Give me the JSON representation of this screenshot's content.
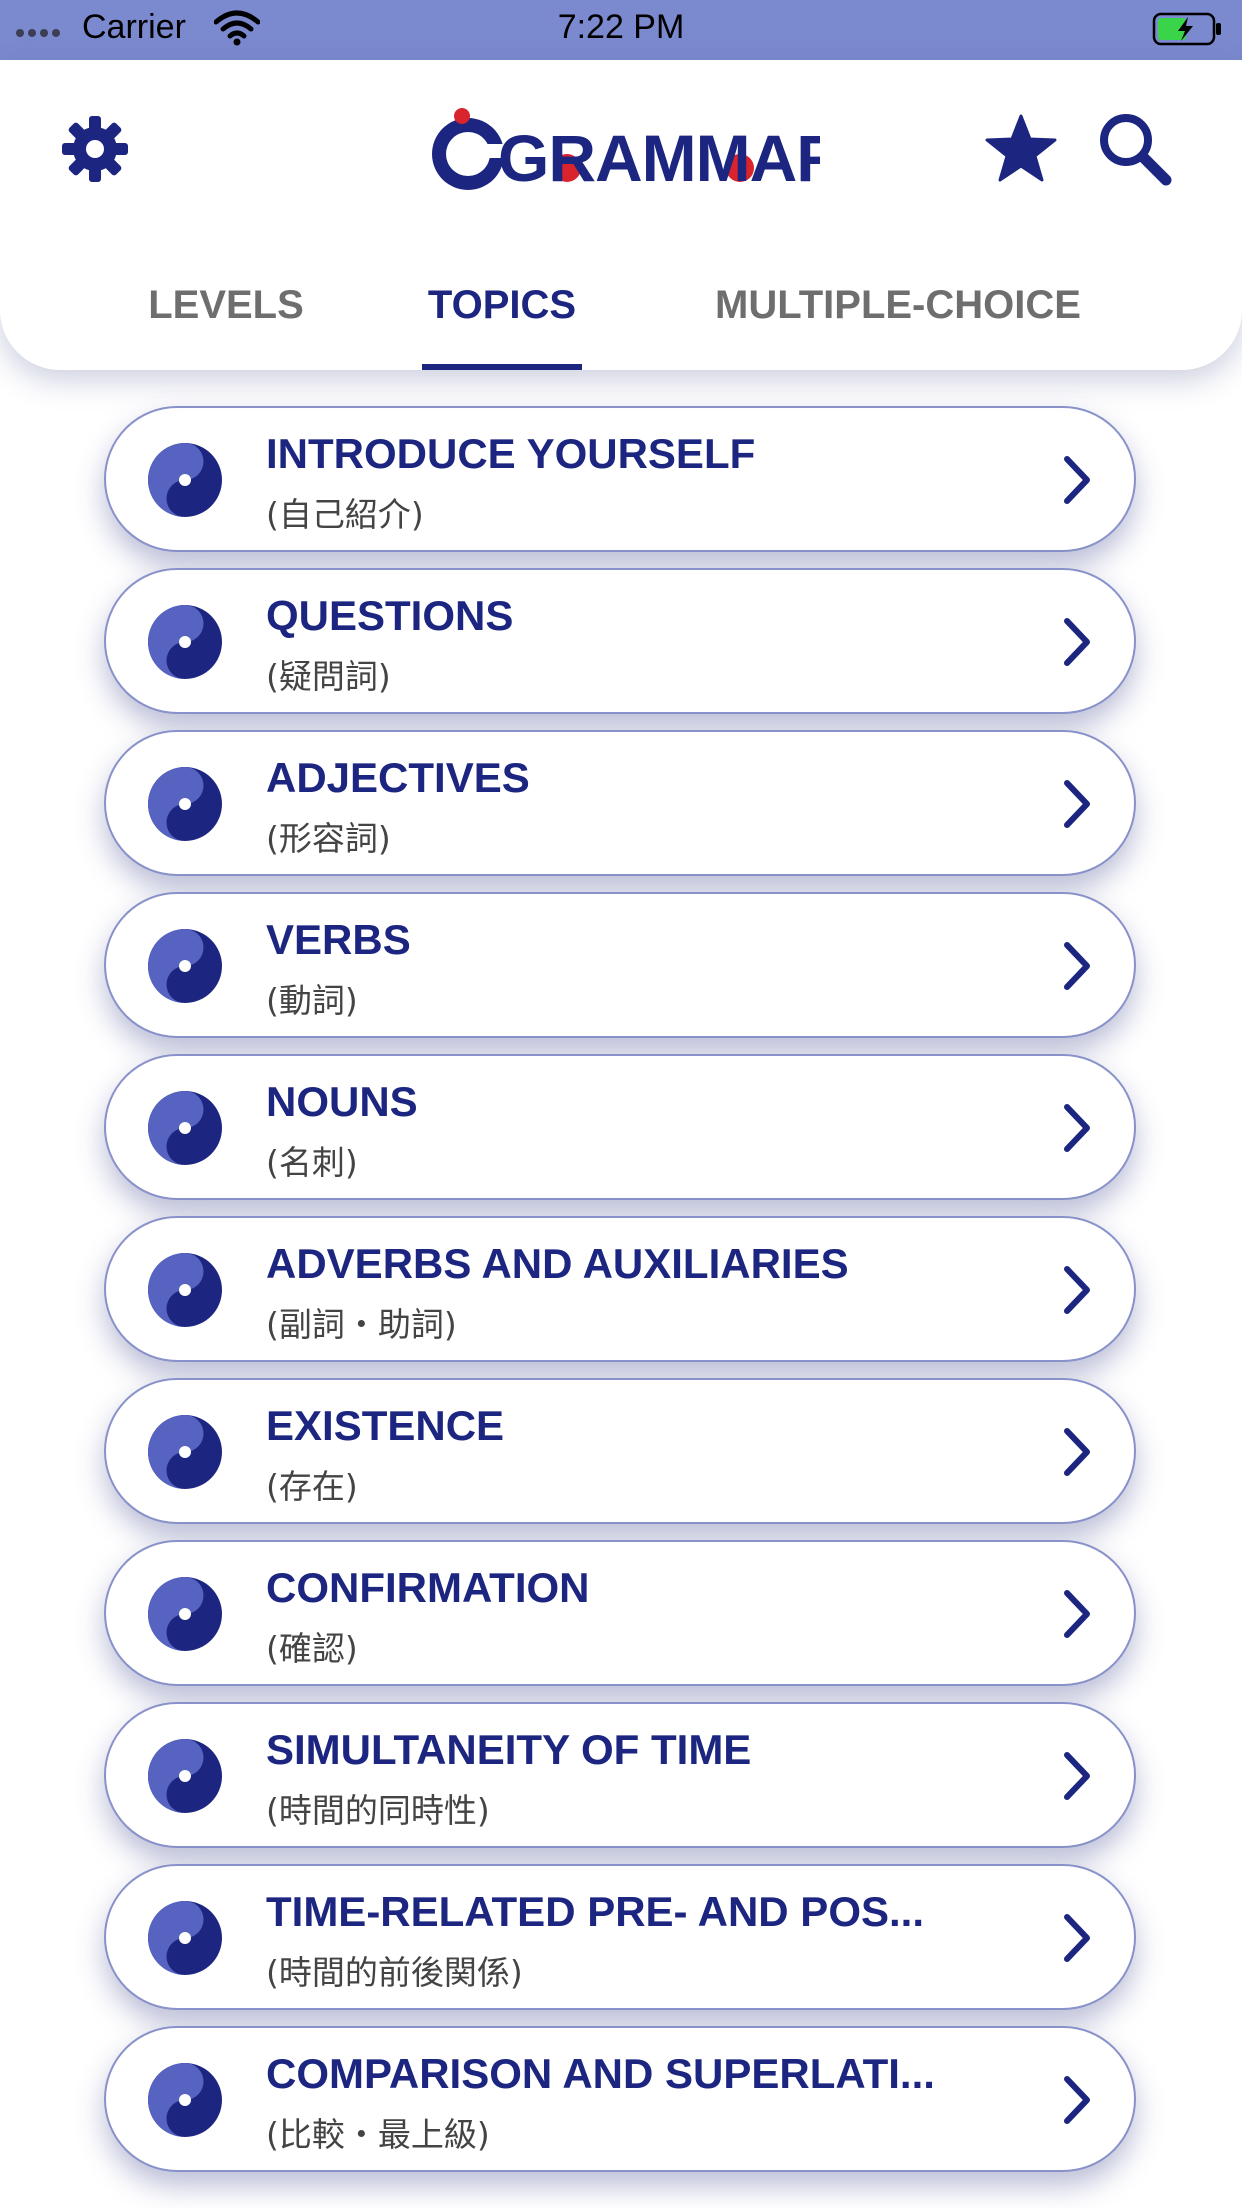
{
  "status_bar": {
    "carrier": "Carrier",
    "time": "7:22 PM"
  },
  "header": {
    "logo_text": "GRAMMAR",
    "icons": {
      "settings": "gear-icon",
      "favorites": "star-icon",
      "search": "search-icon"
    }
  },
  "tabs": [
    {
      "label": "LEVELS",
      "active": false
    },
    {
      "label": "TOPICS",
      "active": true
    },
    {
      "label": "MULTIPLE-CHOICE",
      "active": false
    }
  ],
  "topics": [
    {
      "title": "INTRODUCE YOURSELF",
      "subtitle": "(自己紹介)"
    },
    {
      "title": "QUESTIONS",
      "subtitle": "(疑問詞)"
    },
    {
      "title": "ADJECTIVES",
      "subtitle": "(形容詞)"
    },
    {
      "title": "VERBS",
      "subtitle": "(動詞)"
    },
    {
      "title": "NOUNS",
      "subtitle": "(名刺)"
    },
    {
      "title": "ADVERBS AND AUXILIARIES",
      "subtitle": "(副詞・助詞)"
    },
    {
      "title": "EXISTENCE",
      "subtitle": "(存在)"
    },
    {
      "title": "CONFIRMATION",
      "subtitle": "(確認)"
    },
    {
      "title": "SIMULTANEITY OF TIME",
      "subtitle": "(時間的同時性)"
    },
    {
      "title": "TIME-RELATED PRE- AND POS...",
      "subtitle": "(時間的前後関係)"
    },
    {
      "title": "COMPARISON AND SUPERLATI...",
      "subtitle": "(比較・最上級)"
    }
  ],
  "colors": {
    "primary": "#1c2681",
    "status_bar": "#7b89cf",
    "inactive_tab": "#6e6e6e",
    "card_border": "#8891c9",
    "logo_red": "#d9232d"
  }
}
